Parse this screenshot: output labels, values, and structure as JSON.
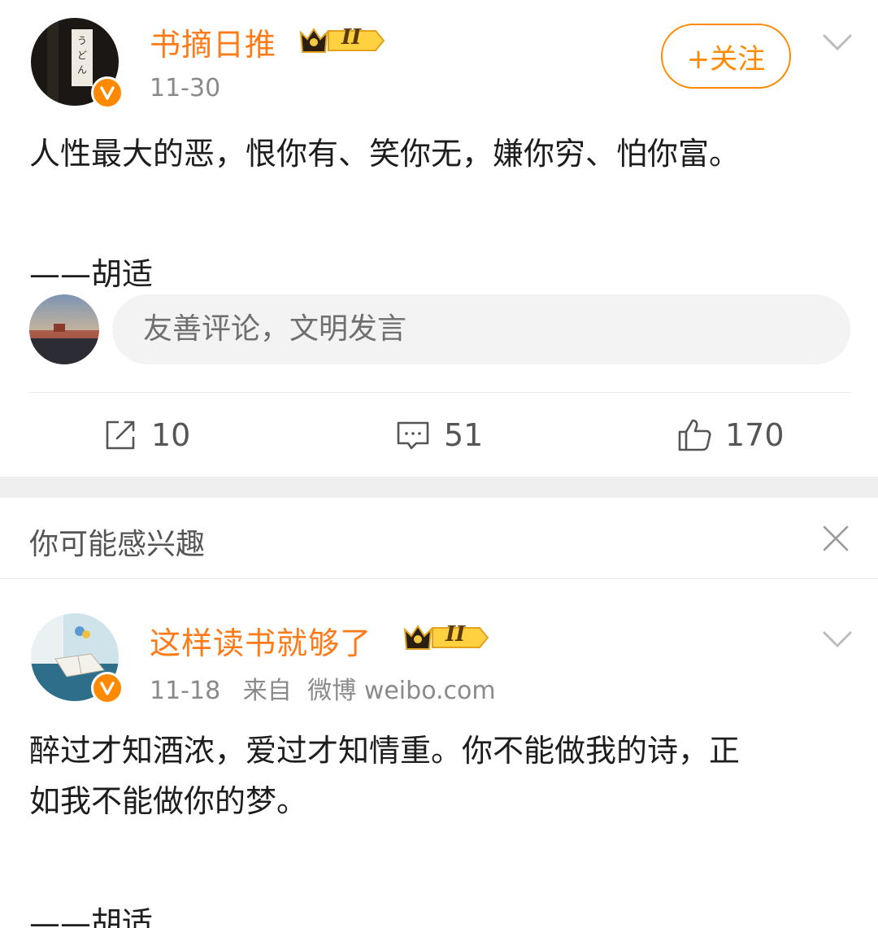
{
  "post1": {
    "username": "书摘日推",
    "level_badge": "II",
    "date": "11-30",
    "follow_label": "+关注",
    "content_lines": [
      "人性最大的恶，恨你有、笑你无，嫌你穷、怕你富。",
      "",
      "——胡适"
    ],
    "comment_placeholder": "友善评论，文明发言",
    "actions": {
      "repost": "10",
      "comments": "51",
      "likes": "170"
    }
  },
  "interest": {
    "title": "你可能感兴趣"
  },
  "post2": {
    "username": "这样读书就够了",
    "level_badge": "II",
    "date": "11-18",
    "source_prefix": "来自",
    "source": "微博 weibo.com",
    "content_line1": "醉过才知酒浓，爱过才知情重。你不能做我的诗，正",
    "content_line2": "如我不能做你的梦。",
    "content_line3": "——胡适"
  },
  "colors": {
    "brand_orange": "#ff8a00",
    "username_orange": "#ff7a18",
    "meta_gray": "#8a8a8a"
  },
  "icons": [
    "chevron-down-icon",
    "verified-v-icon",
    "crown-level-icon",
    "repost-icon",
    "comment-icon",
    "like-icon",
    "close-icon"
  ]
}
